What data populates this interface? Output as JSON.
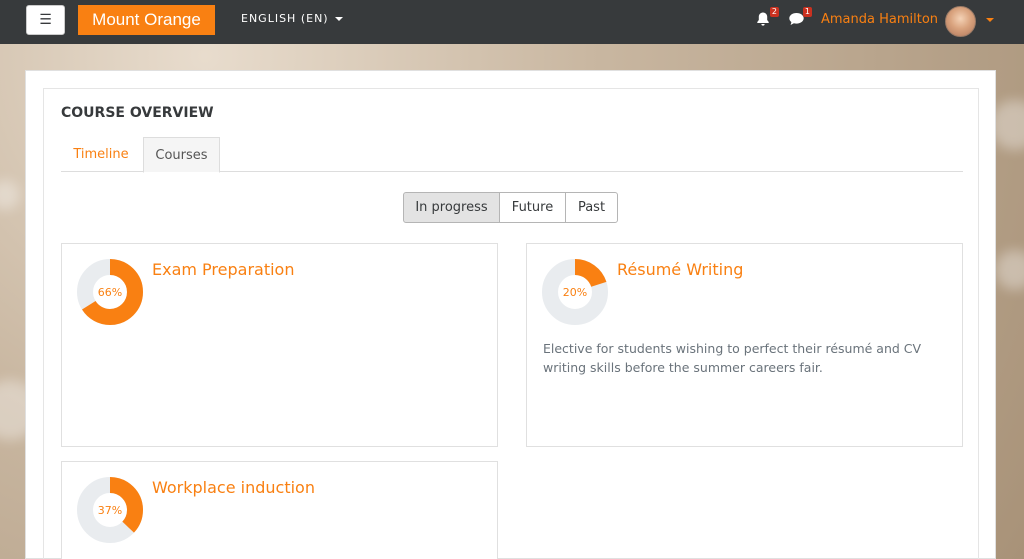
{
  "navbar": {
    "menu_icon": "hamburger-icon",
    "brand": "Mount Orange",
    "language": "ENGLISH (EN)",
    "notifications": {
      "icon": "bell-icon",
      "count": "2"
    },
    "messages": {
      "icon": "speech-bubble-icon",
      "count": "1"
    },
    "user_name": "Amanda Hamilton",
    "accent_color": "#f98012"
  },
  "block": {
    "title": "COURSE OVERVIEW",
    "tabs": [
      {
        "label": "Timeline",
        "active": false
      },
      {
        "label": "Courses",
        "active": true
      }
    ],
    "filters": [
      {
        "label": "In progress",
        "active": true
      },
      {
        "label": "Future",
        "active": false
      },
      {
        "label": "Past",
        "active": false
      }
    ],
    "courses": [
      {
        "name": "Exam Preparation",
        "progress": 66,
        "progress_label": "66%",
        "summary": ""
      },
      {
        "name": "Résumé Writing",
        "progress": 20,
        "progress_label": "20%",
        "summary": "Elective for students wishing to perfect their résumé and CV writing skills before the summer careers fair."
      },
      {
        "name": "Workplace induction",
        "progress": 37,
        "progress_label": "37%",
        "summary": ""
      }
    ]
  }
}
